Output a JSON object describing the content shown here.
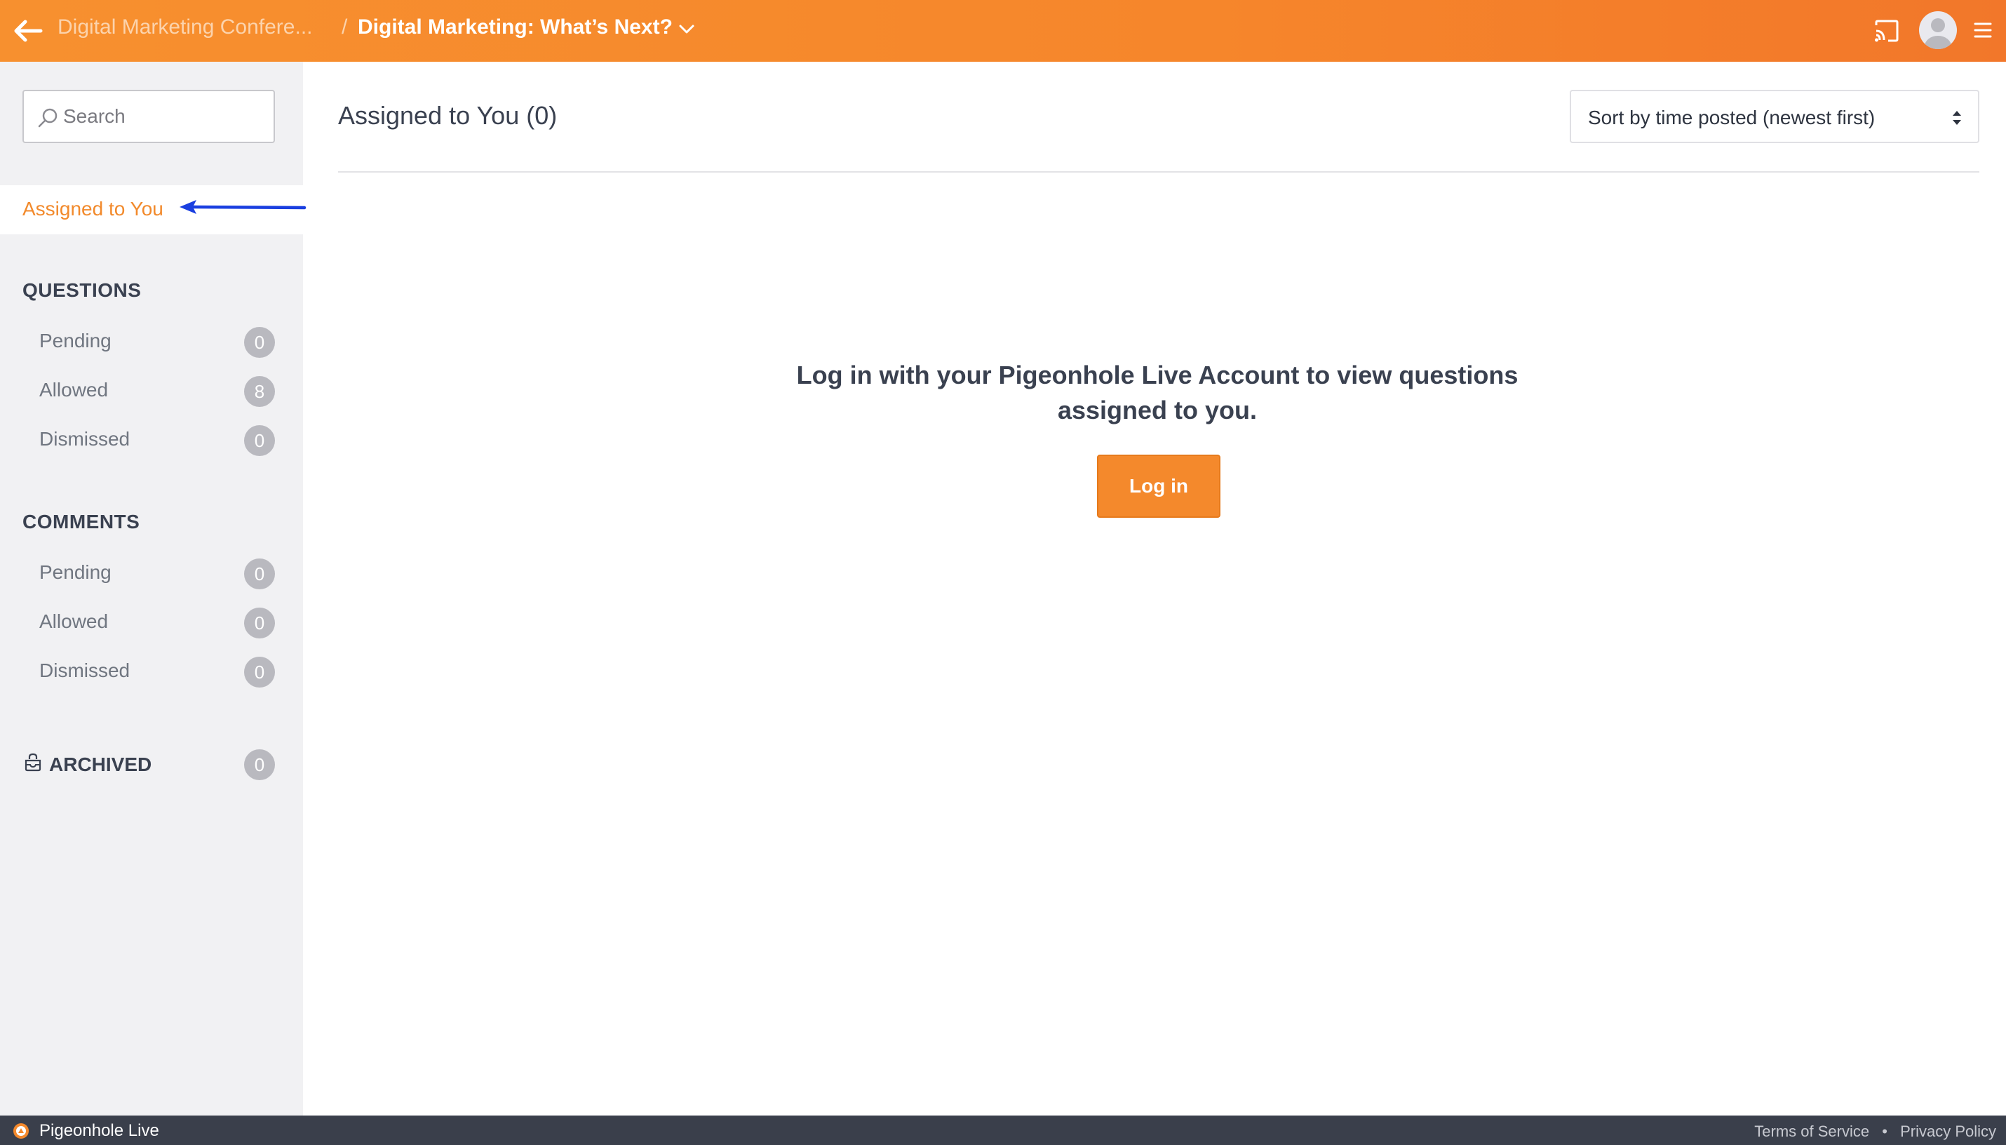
{
  "header": {
    "parent_crumb": "Digital Marketing Confere...",
    "separator": "/",
    "current_crumb": "Digital Marketing: What’s Next?"
  },
  "sidebar": {
    "search_placeholder": "Search",
    "assigned_label": "Assigned to You",
    "questions": {
      "heading": "QUESTIONS",
      "items": [
        {
          "label": "Pending",
          "count": "0"
        },
        {
          "label": "Allowed",
          "count": "8"
        },
        {
          "label": "Dismissed",
          "count": "0"
        }
      ]
    },
    "comments": {
      "heading": "COMMENTS",
      "items": [
        {
          "label": "Pending",
          "count": "0"
        },
        {
          "label": "Allowed",
          "count": "0"
        },
        {
          "label": "Dismissed",
          "count": "0"
        }
      ]
    },
    "archived": {
      "label": "ARCHIVED",
      "count": "0"
    }
  },
  "main": {
    "title": "Assigned to You (0)",
    "sort_label": "Sort by time posted (newest first)",
    "login_message": "Log in with your Pigeonhole Live Account to view questions assigned to you.",
    "login_button": "Log in"
  },
  "footer": {
    "brand": "Pigeonhole Live",
    "terms": "Terms of Service",
    "bullet": "•",
    "privacy": "Privacy Policy"
  },
  "colors": {
    "accent": "#f6862b",
    "annotation_arrow": "#1a3fe0",
    "sidebar_bg": "#f1f1f3",
    "footer_bg": "#3a3f4b"
  },
  "icons": {
    "back": "arrow-left-icon",
    "chevron": "chevron-down-icon",
    "cast": "cast-icon",
    "avatar": "user-avatar-icon",
    "menu": "hamburger-menu-icon",
    "search": "search-icon",
    "archive": "archive-icon",
    "sort": "sort-arrows-icon"
  }
}
